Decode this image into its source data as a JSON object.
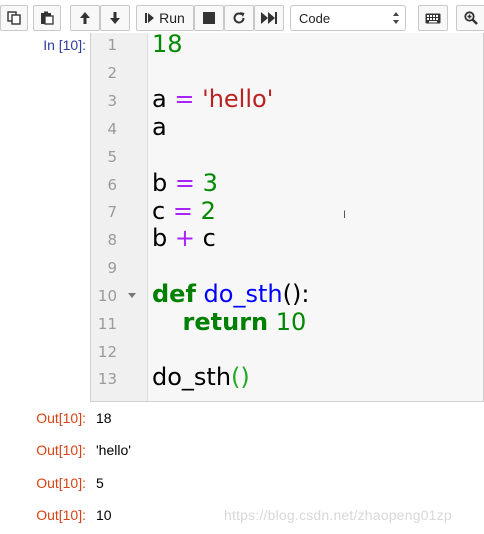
{
  "toolbar": {
    "run_label": "Run",
    "cell_type_value": "Code",
    "cell_type_options": [
      "Code"
    ],
    "buttons": [
      "copy-icon",
      "paste-icon",
      "arrow-up-icon",
      "arrow-down-icon",
      "step-forward-icon",
      "stop-icon",
      "restart-icon",
      "fast-forward-icon",
      "keyboard-icon",
      "zoom-icon"
    ]
  },
  "cell": {
    "in_prompt": "In [10]:",
    "line_numbers": [
      "1",
      "2",
      "3",
      "4",
      "5",
      "6",
      "7",
      "8",
      "9",
      "10",
      "11",
      "12",
      "13"
    ],
    "lines": {
      "l1": {
        "n": "18"
      },
      "l3": {
        "a": "a",
        "eq": " = ",
        "s": "'hello'"
      },
      "l4": {
        "a": "a"
      },
      "l6": {
        "a": "b",
        "eq": " = ",
        "n": "3"
      },
      "l7": {
        "a": "c",
        "eq": " = ",
        "n": "2"
      },
      "l8": {
        "a": "b",
        "op": " + ",
        "c": "c"
      },
      "l10": {
        "kw": "def",
        "sp": " ",
        "name": "do_sth",
        "rest": "():"
      },
      "l11": {
        "indent": "    ",
        "kw": "return",
        "sp": " ",
        "n": "10"
      },
      "l13": {
        "name": "do_sth",
        "paren": "()"
      }
    }
  },
  "outputs": [
    {
      "prompt": "Out[10]:",
      "value": "18"
    },
    {
      "prompt": "Out[10]:",
      "value": "'hello'"
    },
    {
      "prompt": "Out[10]:",
      "value": "5"
    },
    {
      "prompt": "Out[10]:",
      "value": "10"
    }
  ],
  "watermark": "https://blog.csdn.net/zhaopeng01zp",
  "colors": {
    "in_prompt": "#303f9f",
    "out_prompt": "#d84315",
    "number": "#008800",
    "string": "#ba2121",
    "operator": "#aa22ff",
    "keyword": "#008000",
    "def_name": "#0000ff"
  }
}
